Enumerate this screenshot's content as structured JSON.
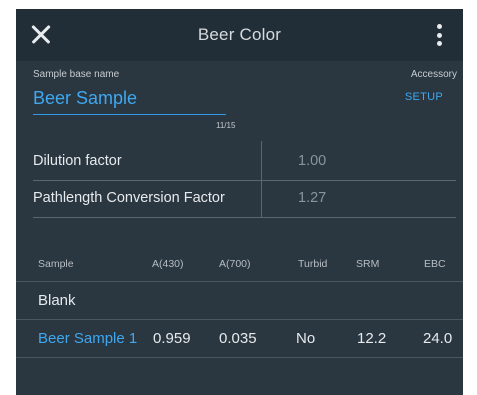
{
  "appbar": {
    "title": "Beer Color",
    "close_icon": "close-icon",
    "more_icon": "more-vert-icon"
  },
  "sample_base": {
    "label": "Sample base name",
    "value": "Beer Sample",
    "char_count": "11/15"
  },
  "accessory": {
    "label": "Accessory",
    "action": "SETUP"
  },
  "factors": {
    "dilution": {
      "label": "Dilution factor",
      "value": "1.00"
    },
    "pathlength": {
      "label": "Pathlength Conversion Factor",
      "value": "1.27"
    }
  },
  "table": {
    "columns": [
      "Sample",
      "A(430)",
      "A(700)",
      "Turbid",
      "SRM",
      "EBC"
    ],
    "blank_label": "Blank",
    "rows": [
      {
        "sample": "Beer Sample 1",
        "a430": "0.959",
        "a700": "0.035",
        "turbid": "No",
        "srm": "12.2",
        "ebc": "24.0"
      }
    ]
  },
  "colors": {
    "background": "#2a3640",
    "appbar": "#222e37",
    "accent": "#3ea8f0"
  }
}
